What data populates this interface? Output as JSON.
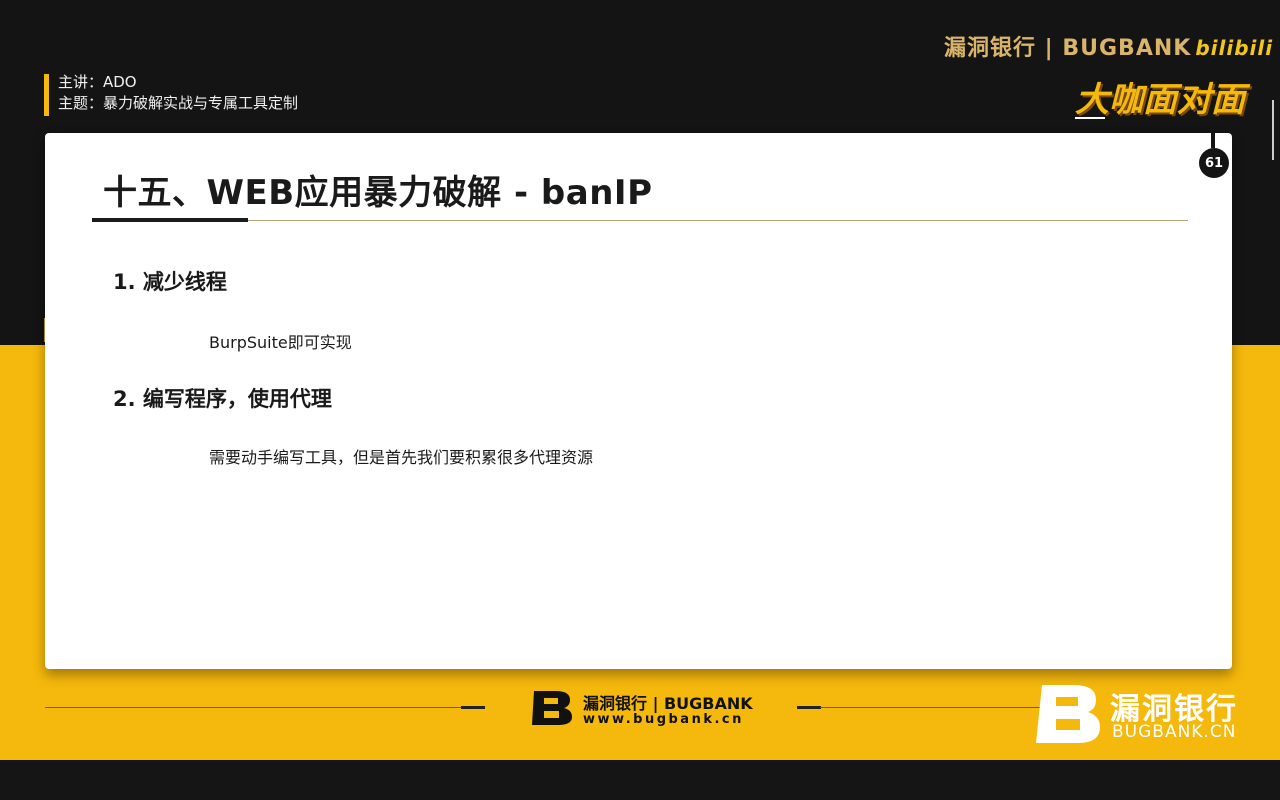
{
  "header": {
    "brand": "漏洞银行 | BUGBANK",
    "bilibili": "bilibili",
    "slogan": "大咖面对面"
  },
  "speaker": {
    "presenter": "主讲：ADO",
    "topic": "主题：暴力破解实战与专属工具定制"
  },
  "slide": {
    "page_number": "61",
    "title": "十五、WEB应用暴力破解 - banIP",
    "items": [
      {
        "heading": "1. 减少线程",
        "body": "BurpSuite即可实现"
      },
      {
        "heading": "2. 编写程序，使用代理",
        "body": "需要动手编写工具，但是首先我们要积累很多代理资源"
      }
    ]
  },
  "footer": {
    "brand": "漏洞银行 | BUGBANK",
    "url": "www.bugbank.cn"
  },
  "watermark": {
    "name": "漏洞银行",
    "url": "BUGBANK.CN"
  },
  "colors": {
    "accent_yellow": "#f5b80c",
    "dark": "#141414",
    "card": "#ffffff"
  }
}
